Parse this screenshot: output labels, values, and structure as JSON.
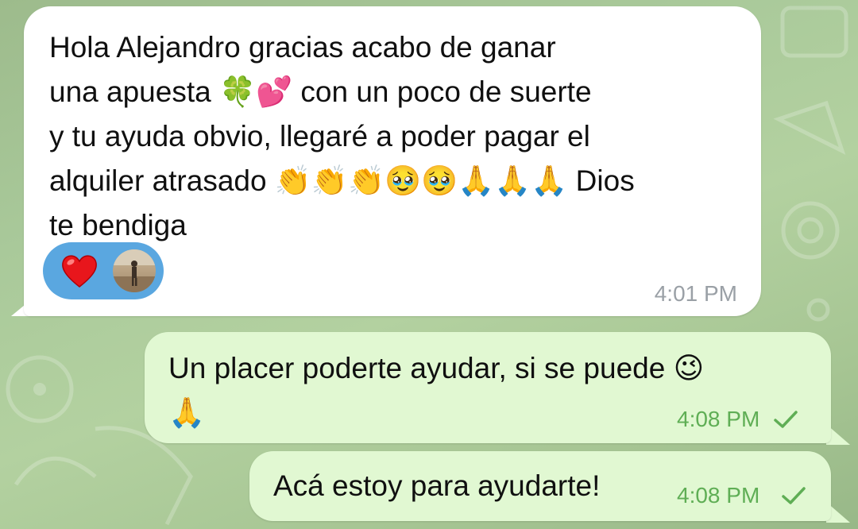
{
  "conversation": {
    "incoming": {
      "text_line1": "Hola Alejandro gracias acabo de ganar",
      "text_line2_start": "una apuesta ",
      "text_line2_emoji": "🍀💕",
      "text_line2_end": " con un poco de suerte",
      "text_line3": "y tu ayuda obvio, llegaré a poder pagar el",
      "text_line4_start": "alquiler atrasado ",
      "text_line4_emoji": "👏👏👏🥹🥹🙏🙏🙏",
      "text_line4_end": " Dios",
      "text_line5": "te bendiga",
      "reaction_emoji_icon": "red-heart-icon",
      "time": "4:01 PM"
    },
    "outgoing": [
      {
        "text_line1": "Un placer poderte ayudar, si se puede ",
        "text_line1_emoji": "😉",
        "text_line2_emoji": "🙏",
        "time": "4:08 PM",
        "status_icon": "check-icon"
      },
      {
        "text": "Acá estoy para ayudarte!",
        "time": "4:08 PM",
        "status_icon": "check-icon"
      }
    ]
  },
  "colors": {
    "incoming_bubble": "#ffffff",
    "outgoing_bubble": "#e1f8d2",
    "outgoing_time": "#5fae55",
    "reaction_pill": "#5aa7e0"
  }
}
